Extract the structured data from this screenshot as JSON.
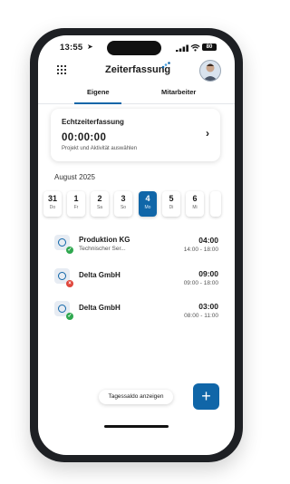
{
  "status_bar": {
    "time": "13:55",
    "battery": "80"
  },
  "header": {
    "title": "Zeiterfassung"
  },
  "tabs": [
    {
      "label": "Eigene"
    },
    {
      "label": "Mitarbeiter"
    }
  ],
  "realtime": {
    "title": "Echtzeiterfassung",
    "timer": "00:00:00",
    "hint": "Projekt und Aktivität auswählen"
  },
  "calendar": {
    "month": "August 2025",
    "days": [
      {
        "num": "31",
        "wd": "Do"
      },
      {
        "num": "1",
        "wd": "Fr"
      },
      {
        "num": "2",
        "wd": "Sa"
      },
      {
        "num": "3",
        "wd": "So"
      },
      {
        "num": "4",
        "wd": "Mo",
        "selected": true
      },
      {
        "num": "5",
        "wd": "Di"
      },
      {
        "num": "6",
        "wd": "Mi"
      }
    ]
  },
  "entries": [
    {
      "name": "Produktion KG",
      "subtitle": "Technischer Ser...",
      "duration": "04:00",
      "range": "14:00 - 18:00",
      "status": "ok"
    },
    {
      "name": "Delta GmbH",
      "subtitle": "",
      "duration": "09:00",
      "range": "09:00 - 18:00",
      "status": "error"
    },
    {
      "name": "Delta GmbH",
      "subtitle": "",
      "duration": "03:00",
      "range": "08:00 - 11:00",
      "status": "ok"
    }
  ],
  "actions": {
    "saldo_label": "Tagessaldo anzeigen",
    "fab_label": "+"
  },
  "colors": {
    "accent": "#1066a8",
    "ok": "#2fa84f",
    "error": "#e0463c"
  }
}
